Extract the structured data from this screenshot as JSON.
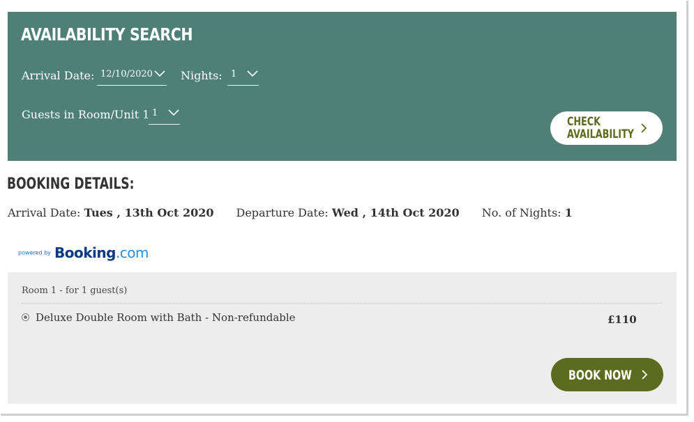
{
  "search": {
    "title": "AVAILABILITY SEARCH",
    "arrival_label": "Arrival Date:",
    "arrival_value": "12/10/2020",
    "nights_label": "Nights:",
    "nights_value": "1",
    "guests_label": "Guests in Room/Unit 1",
    "guests_value": "1",
    "check_button": "CHECK\nAVAILABILITY"
  },
  "details": {
    "title": "BOOKING DETAILS:",
    "arrival_label": "Arrival Date: ",
    "arrival_value": "Tues , 13th Oct 2020",
    "departure_label": "Departure Date: ",
    "departure_value": "Wed , 14th Oct 2020",
    "nights_label": "No. of Nights: ",
    "nights_value": "1"
  },
  "powered": {
    "prefix": "powered by",
    "brand": "Booking",
    "brand_suffix": ".com"
  },
  "rooms": {
    "header": "Room 1 - for 1 guest(s)",
    "items": [
      {
        "name": "Deluxe Double Room with Bath - Non-refundable",
        "price": "£110"
      }
    ],
    "book_button": "BOOK NOW"
  },
  "colors": {
    "panel": "#4f8078",
    "accent": "#5c6b1f",
    "room_panel": "#eeeded"
  },
  "icons": [
    "chevron-down-icon",
    "chevron-right-icon",
    "radio-selected-icon",
    "booking-logo"
  ]
}
